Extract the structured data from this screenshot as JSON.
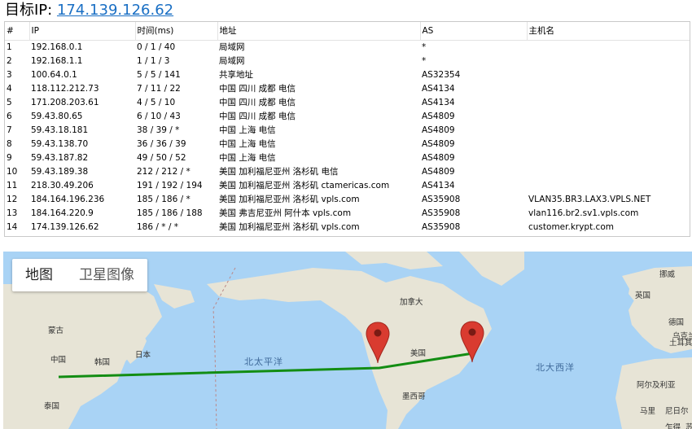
{
  "header": {
    "label": "目标IP:",
    "ip": "174.139.126.62"
  },
  "table": {
    "columns": [
      "#",
      "IP",
      "时间(ms)",
      "地址",
      "AS",
      "主机名"
    ],
    "rows": [
      [
        "1",
        "192.168.0.1",
        "0 / 1 / 40",
        "局域网",
        "*",
        ""
      ],
      [
        "2",
        "192.168.1.1",
        "1 / 1 / 3",
        "局域网",
        "*",
        ""
      ],
      [
        "3",
        "100.64.0.1",
        "5 / 5 / 141",
        "共享地址",
        "AS32354",
        ""
      ],
      [
        "4",
        "118.112.212.73",
        "7 / 11 / 22",
        "中国 四川 成都 电信",
        "AS4134",
        ""
      ],
      [
        "5",
        "171.208.203.61",
        "4 / 5 / 10",
        "中国 四川 成都 电信",
        "AS4134",
        ""
      ],
      [
        "6",
        "59.43.80.65",
        "6 / 10 / 43",
        "中国 四川 成都 电信",
        "AS4809",
        ""
      ],
      [
        "7",
        "59.43.18.181",
        "38 / 39 / *",
        "中国 上海 电信",
        "AS4809",
        ""
      ],
      [
        "8",
        "59.43.138.70",
        "36 / 36 / 39",
        "中国 上海 电信",
        "AS4809",
        ""
      ],
      [
        "9",
        "59.43.187.82",
        "49 / 50 / 52",
        "中国 上海 电信",
        "AS4809",
        ""
      ],
      [
        "10",
        "59.43.189.38",
        "212 / 212 / *",
        "美国 加利福尼亚州 洛杉矶 电信",
        "AS4809",
        ""
      ],
      [
        "11",
        "218.30.49.206",
        "191 / 192 / 194",
        "美国 加利福尼亚州 洛杉矶 ctamericas.com",
        "AS4134",
        ""
      ],
      [
        "12",
        "184.164.196.236",
        "185 / 186 / *",
        "美国 加利福尼亚州 洛杉矶 vpls.com",
        "AS35908",
        "VLAN35.BR3.LAX3.VPLS.NET"
      ],
      [
        "13",
        "184.164.220.9",
        "185 / 186 / 188",
        "美国 弗吉尼亚州 阿什本 vpls.com",
        "AS35908",
        "vlan116.br2.sv1.vpls.com"
      ],
      [
        "14",
        "174.139.126.62",
        "186 / * / *",
        "美国 加利福尼亚州 洛杉矶 vpls.com",
        "AS35908",
        "customer.krypt.com"
      ]
    ]
  },
  "map": {
    "tabs": [
      "地图",
      "卫星图像"
    ],
    "labels": {
      "mongolia": "蒙古",
      "china": "中国",
      "korea": "韩国",
      "japan": "日本",
      "thailand": "泰国",
      "pacific": "北太平洋",
      "atlantic": "北大西洋",
      "canada": "加拿大",
      "usa": "美国",
      "mexico": "墨西哥",
      "uk": "英国",
      "norway": "挪威",
      "germany": "德国",
      "ukraine": "乌克兰",
      "turkey": "土耳其",
      "algeria": "阿尔及利亚",
      "mali": "马里",
      "niger": "尼日尔",
      "chad": "乍得",
      "sudan": "苏丹"
    },
    "colors": {
      "ocean": "#a9d3f5",
      "land": "#e7e4d6",
      "route": "#138d13",
      "marker": "#d93b30"
    },
    "markers": [
      "marker-los-angeles",
      "marker-ashburn"
    ]
  }
}
